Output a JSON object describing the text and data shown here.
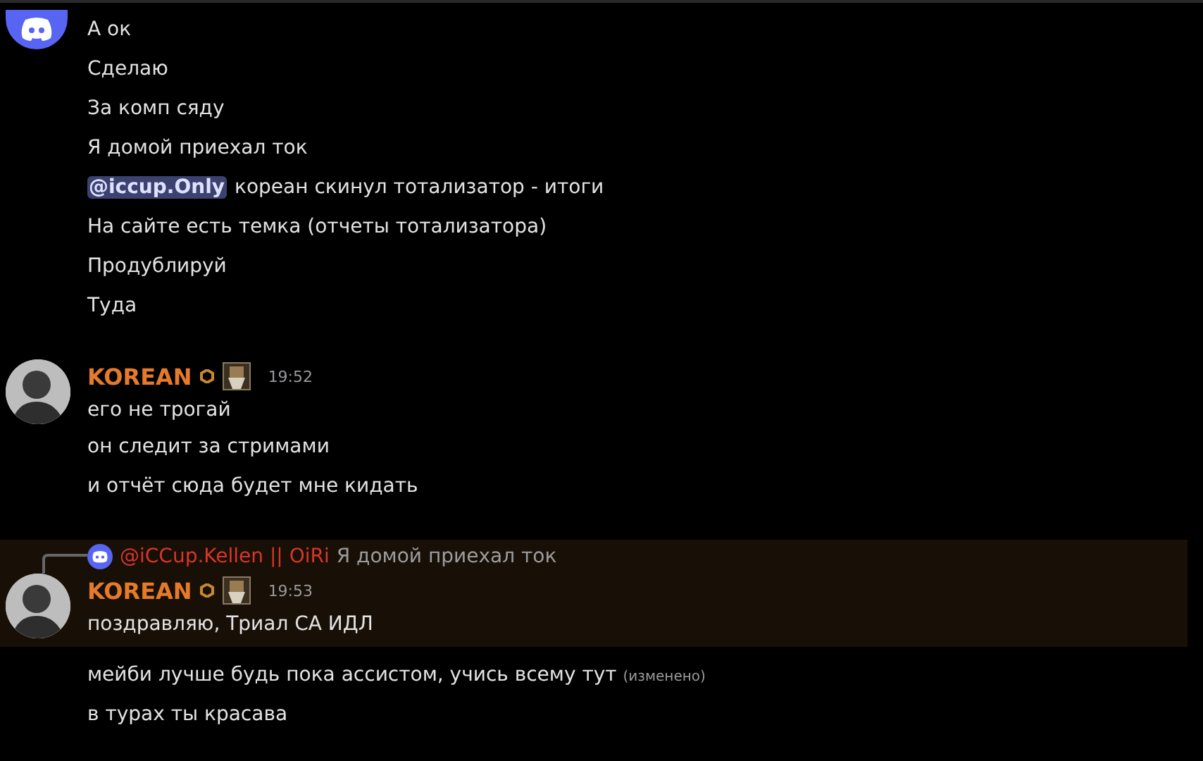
{
  "groups": [
    {
      "kind": "logo",
      "highlighted": false,
      "messages": [
        {
          "text": "А ок"
        },
        {
          "text": "Сделаю"
        },
        {
          "text": "За комп сяду"
        },
        {
          "text": "Я домой приехал ток"
        },
        {
          "mention": "@iccup.Only",
          "text": "кореан скинул тотализатор - итоги"
        },
        {
          "text": "На сайте есть темка (отчеты тотализатора)"
        },
        {
          "text": "Продублируй"
        },
        {
          "text": "Туда"
        }
      ]
    },
    {
      "kind": "person",
      "highlighted": false,
      "author": {
        "name": "KOREAN",
        "time": "19:52"
      },
      "messages": [
        {
          "text": "его не трогай"
        },
        {
          "text": "он следит за стримами"
        },
        {
          "text": "и отчёт сюда будет мне кидать"
        }
      ]
    },
    {
      "kind": "person",
      "highlighted": true,
      "reply": {
        "name": "@iCCup.Kellen || OiRi",
        "text": "Я домой приехал ток"
      },
      "author": {
        "name": "KOREAN",
        "time": "19:53"
      },
      "messages": [
        {
          "text": "поздравляю, Триал СА ИДЛ"
        }
      ]
    },
    {
      "kind": "none",
      "highlighted": false,
      "messages": [
        {
          "text": "мейби лучше будь пока ассистом, учись всему тут",
          "edited": "(изменено)"
        },
        {
          "text": "в турах ты красава"
        }
      ]
    }
  ]
}
